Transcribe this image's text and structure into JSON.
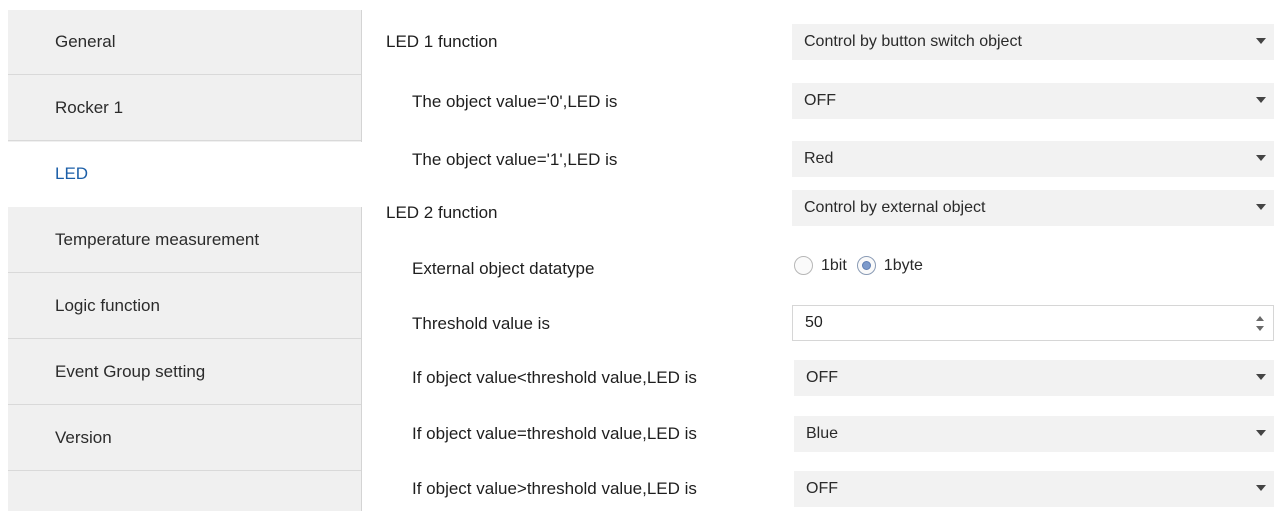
{
  "sidebar": {
    "items": [
      {
        "label": "General"
      },
      {
        "label": "Rocker 1"
      },
      {
        "label": "LED"
      },
      {
        "label": "Temperature measurement"
      },
      {
        "label": "Logic function"
      },
      {
        "label": "Event Group setting"
      },
      {
        "label": "Version"
      }
    ],
    "active": "LED"
  },
  "main": {
    "led1_function": {
      "label": "LED 1 function",
      "value": "Control by button switch object"
    },
    "obj0": {
      "label": "The object value='0',LED is",
      "value": "OFF"
    },
    "obj1": {
      "label": "The object value='1',LED is",
      "value": "Red"
    },
    "led2_function": {
      "label": "LED 2 function",
      "value": "Control by external object"
    },
    "datatype": {
      "label": "External object datatype",
      "options": [
        "1bit",
        "1byte"
      ],
      "selected": "1byte"
    },
    "threshold": {
      "label": "Threshold value is",
      "value": "50"
    },
    "lt": {
      "label": "If object value<threshold value,LED is",
      "value": "OFF"
    },
    "eq": {
      "label": "If object value=threshold value,LED is",
      "value": "Blue"
    },
    "gt": {
      "label": "If object value>threshold value,LED is",
      "value": "OFF"
    }
  },
  "icons": {
    "caret": "chevron-down-icon",
    "spinner": "spinner-arrows-icon"
  }
}
